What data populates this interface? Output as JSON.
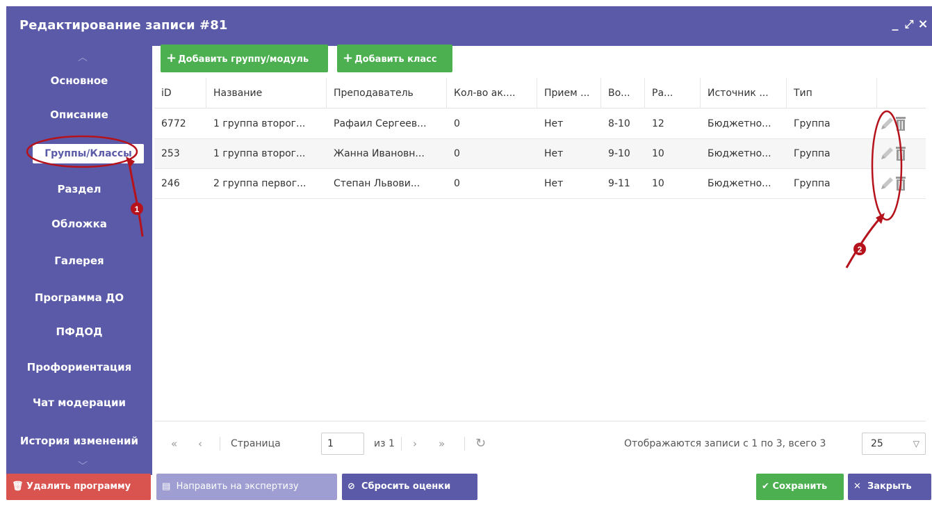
{
  "window": {
    "title": "Редактирование записи #81",
    "controls": {
      "minimize": "_",
      "maximize": "⤢",
      "close": "×"
    }
  },
  "sidebar": {
    "items": [
      {
        "label": "Основное"
      },
      {
        "label": "Описание"
      },
      {
        "label": "Группы/Классы",
        "active": true
      },
      {
        "label": "Раздел"
      },
      {
        "label": "Обложка"
      },
      {
        "label": "Галерея"
      },
      {
        "label": "Программа ДО"
      },
      {
        "label": "ПФДОД"
      },
      {
        "label": "Профориентация"
      },
      {
        "label": "Чат модерации"
      },
      {
        "label": "История изменений"
      }
    ]
  },
  "toolbar": {
    "add_group_label": "Добавить группу/модуль",
    "add_class_label": "Добавить класс"
  },
  "table": {
    "columns": [
      "iD",
      "Название",
      "Преподаватель",
      "Кол-во ак....",
      "Прием ...",
      "Во...",
      "Ра...",
      "Источник ...",
      "Тип"
    ],
    "rows": [
      [
        "6772",
        "1 группа второг...",
        "Рафаил Сергеев...",
        "0",
        "Нет",
        "8-10",
        "12",
        "Бюджетно...",
        "Группа"
      ],
      [
        "253",
        "1 группа второг...",
        "Жанна Ивановн...",
        "0",
        "Нет",
        "9-10",
        "10",
        "Бюджетно...",
        "Группа"
      ],
      [
        "246",
        "2 группа первог...",
        "Степан Львови...",
        "0",
        "Нет",
        "9-11",
        "10",
        "Бюджетно...",
        "Группа"
      ]
    ]
  },
  "pager": {
    "page_label": "Страница",
    "page_value": "1",
    "of_label": "из 1",
    "summary": "Отображаются записи с 1 по 3, всего 3",
    "page_size": "25"
  },
  "footer": {
    "delete_label": "Удалить программу",
    "expert_label": "Направить на экспертизу",
    "reset_label": "Сбросить оценки",
    "save_label": "Сохранить",
    "close_label": "Закрыть"
  },
  "annotations": {
    "marker_1": "1",
    "marker_2": "2"
  },
  "colors": {
    "primary": "#5a5aa8",
    "success": "#4caf50",
    "danger": "#d9534f",
    "annotation": "#b5121b"
  }
}
